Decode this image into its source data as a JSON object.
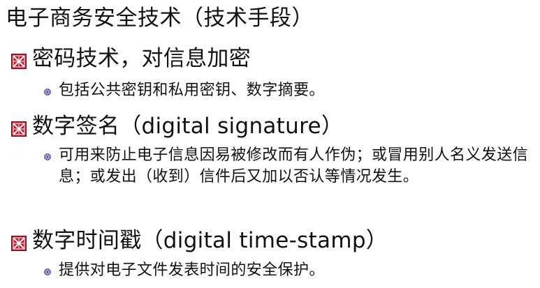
{
  "slide": {
    "title": "电子商务安全技术（技术手段）",
    "items": [
      {
        "text": "密码技术，对信息加密",
        "sub": "包括公共密钥和私用密钥、数字摘要。"
      },
      {
        "text": "数字签名（digital signature）",
        "sub": "可用来防止电子信息因易被修改而有人作伪；或冒用别人名义发送信息；或发出（收到）信件后又加以否认等情况发生。"
      },
      {
        "text": "数字时间戳（digital time-stamp）",
        "sub": "提供对电子文件发表时间的安全保护。"
      }
    ]
  },
  "colors": {
    "bullet_primary": "#c0182c",
    "bullet_secondary": "#3a3aa8"
  }
}
